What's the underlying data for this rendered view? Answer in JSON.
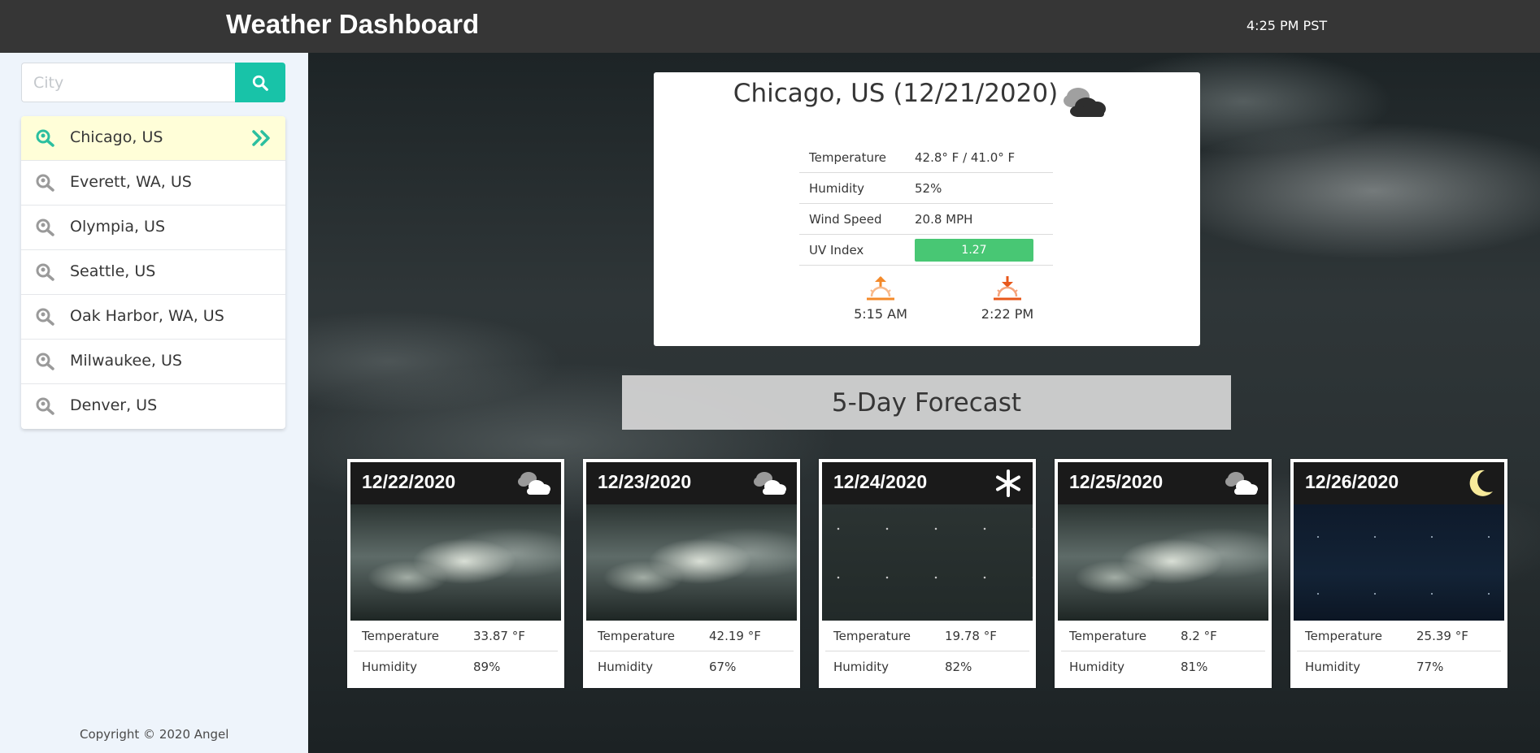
{
  "header": {
    "title": "Weather Dashboard",
    "time": "4:25 PM PST"
  },
  "search": {
    "placeholder": "City",
    "value": "",
    "button_icon": "search-icon"
  },
  "sidebar": {
    "cities": [
      {
        "label": "Chicago, US",
        "active": true
      },
      {
        "label": "Everett, WA, US"
      },
      {
        "label": "Olympia, US"
      },
      {
        "label": "Seattle, US"
      },
      {
        "label": "Oak Harbor, WA, US"
      },
      {
        "label": "Milwaukee, US"
      },
      {
        "label": "Denver, US"
      }
    ],
    "copyright": "Copyright © 2020 Angel"
  },
  "current": {
    "title": "Chicago, US (12/21/2020)",
    "icon": "cloudy-icon",
    "stats": [
      {
        "label": "Temperature",
        "value": "42.8° F / 41.0° F"
      },
      {
        "label": "Humidity",
        "value": "52%"
      },
      {
        "label": "Wind Speed",
        "value": "20.8 MPH"
      },
      {
        "label": "UV Index",
        "value": "1.27"
      }
    ],
    "uv_color": "#48c774",
    "sunrise": "5:15 AM",
    "sunset": "2:22 PM"
  },
  "forecast": {
    "heading": "5-Day Forecast",
    "days": [
      {
        "date": "12/22/2020",
        "icon": "cloudy-icon",
        "temp_label": "Temperature",
        "temp": "33.87 °F",
        "hum_label": "Humidity",
        "humidity": "89%"
      },
      {
        "date": "12/23/2020",
        "icon": "cloudy-icon",
        "temp_label": "Temperature",
        "temp": "42.19 °F",
        "hum_label": "Humidity",
        "humidity": "67%"
      },
      {
        "date": "12/24/2020",
        "icon": "snowflake-icon",
        "temp_label": "Temperature",
        "temp": "19.78 °F",
        "hum_label": "Humidity",
        "humidity": "82%"
      },
      {
        "date": "12/25/2020",
        "icon": "cloudy-icon",
        "temp_label": "Temperature",
        "temp": "8.2 °F",
        "hum_label": "Humidity",
        "humidity": "81%"
      },
      {
        "date": "12/26/2020",
        "icon": "moon-icon",
        "temp_label": "Temperature",
        "temp": "25.39 °F",
        "hum_label": "Humidity",
        "humidity": "77%"
      }
    ]
  },
  "colors": {
    "header_bg": "#363636",
    "accent": "#18c3a8",
    "active_row": "#fffed8",
    "sunrise": "#f48a2a",
    "sunset": "#e8571a"
  }
}
